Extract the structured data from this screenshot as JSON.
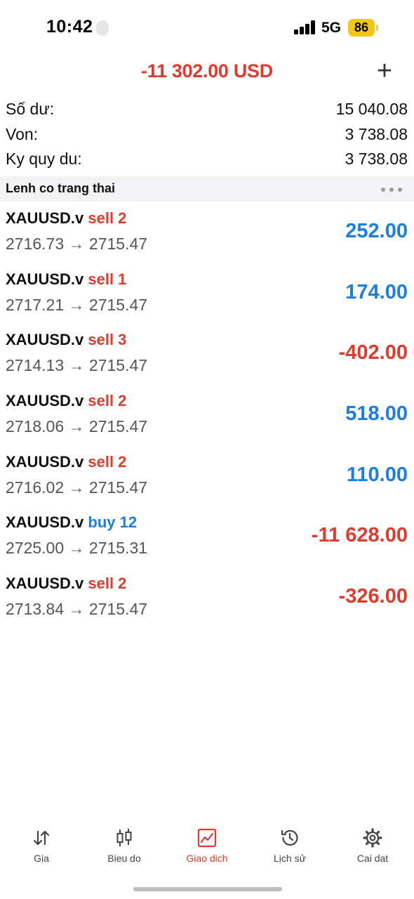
{
  "status_bar": {
    "time": "10:42",
    "network": "5G",
    "battery": "86"
  },
  "header": {
    "total_pl": "-11 302.00 USD",
    "add_label": "+"
  },
  "summary": [
    {
      "label": "Số dư:",
      "value": "15 040.08"
    },
    {
      "label": "Von:",
      "value": "3 738.08"
    },
    {
      "label": "Ky quy du:",
      "value": "3 738.08"
    }
  ],
  "section": {
    "title": "Lenh co trang thai",
    "menu_icon": "more-horizontal-icon"
  },
  "positions": [
    {
      "symbol": "XAUUSD.v",
      "side": "sell 2",
      "side_type": "sell",
      "prices": "2716.73 → 2715.47",
      "pl": "252.00",
      "pl_sign": "pos"
    },
    {
      "symbol": "XAUUSD.v",
      "side": "sell 1",
      "side_type": "sell",
      "prices": "2717.21 → 2715.47",
      "pl": "174.00",
      "pl_sign": "pos"
    },
    {
      "symbol": "XAUUSD.v",
      "side": "sell 3",
      "side_type": "sell",
      "prices": "2714.13 → 2715.47",
      "pl": "-402.00",
      "pl_sign": "neg"
    },
    {
      "symbol": "XAUUSD.v",
      "side": "sell 2",
      "side_type": "sell",
      "prices": "2718.06 → 2715.47",
      "pl": "518.00",
      "pl_sign": "pos"
    },
    {
      "symbol": "XAUUSD.v",
      "side": "sell 2",
      "side_type": "sell",
      "prices": "2716.02 → 2715.47",
      "pl": "110.00",
      "pl_sign": "pos"
    },
    {
      "symbol": "XAUUSD.v",
      "side": "buy 12",
      "side_type": "buy",
      "prices": "2725.00 → 2715.31",
      "pl": "-11 628.00",
      "pl_sign": "neg"
    },
    {
      "symbol": "XAUUSD.v",
      "side": "sell 2",
      "side_type": "sell",
      "prices": "2713.84 → 2715.47",
      "pl": "-326.00",
      "pl_sign": "neg"
    }
  ],
  "nav": [
    {
      "label": "Gia",
      "icon": "quotes-arrows-icon",
      "active": false
    },
    {
      "label": "Bieu do",
      "icon": "candlestick-chart-icon",
      "active": false
    },
    {
      "label": "Giao dich",
      "icon": "trade-chart-icon",
      "active": true
    },
    {
      "label": "Lịch sử",
      "icon": "history-clock-icon",
      "active": false
    },
    {
      "label": "Cai dat",
      "icon": "settings-gear-icon",
      "active": false
    }
  ],
  "colors": {
    "negative": "#e03a2d",
    "positive": "#1a7fe0",
    "active_tab": "#e03a2d"
  }
}
